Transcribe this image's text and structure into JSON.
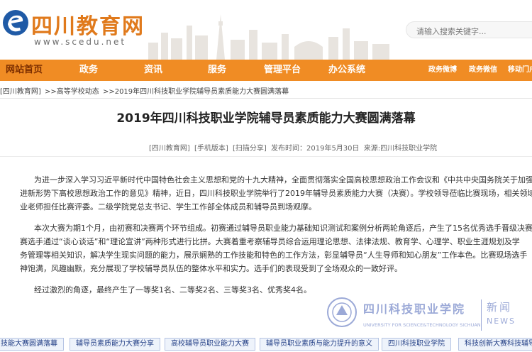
{
  "header": {
    "site_name": "四川教育网",
    "site_url": "www.scedu.net",
    "search_placeholder": "请输入搜索关键字..."
  },
  "nav": {
    "items": [
      {
        "label": "网站首页",
        "active": true
      },
      {
        "label": "政务"
      },
      {
        "label": "资讯"
      },
      {
        "label": "服务"
      },
      {
        "label": "管理平台"
      },
      {
        "label": "办公系统"
      }
    ],
    "right": [
      "政务微博",
      "政务微信",
      "移动门户"
    ]
  },
  "breadcrumb": [
    "[四川教育网]",
    ">>高等学校动态",
    ">>2019年四川科技职业学院辅导员素质能力大赛圆满落幕"
  ],
  "article": {
    "title": "2019年四川科技职业学院辅导员素质能力大赛圆满落幕",
    "meta": [
      "[四川教育网]",
      "[手机版本]",
      "[扫描分享]",
      "发布时间：2019年5月30日",
      "来源:四川科技职业学院"
    ],
    "paragraphs": [
      {
        "lines": [
          "为进一步深入学习习近平新时代中国特色社会主义思想和党的十九大精神，全面贯彻落实全国高校思想政治工作会议和《中共中央国务院关于加强",
          "进新形势下高校思想政治工作的意见》精神，近日，四川科技职业学院举行了2019年辅导员素质能力大赛（决赛）。学校领导莅临比赛现场，相关领域",
          "业老师担任比赛评委。二级学院党总支书记、学生工作部全体成员和辅导员到场观摩。"
        ]
      },
      {
        "lines": [
          "本次大赛为期1个月，由初赛和决赛两个环节组成。初赛通过辅导员职业能力基础知识测试和案例分析两轮角逐后，产生了15名优秀选手晋级决赛。",
          "赛选手通过“谈心谈话”和“理论宣讲”两种形式进行比拼。大赛着重考察辅导员综合运用理论思想、法律法规、教育学、心理学、职业生涯规划及学",
          "务管理等相关知识，解决学生现实问题的能力，展示娴熟的工作技能和特色的工作方法，彰显辅导员“人生导师和知心朋友”工作本色。比赛现场选手",
          "神饱满，风趣幽默，充分展现了学校辅导员队伍的整体水平和实力。选手们的表现受到了全场观众的一致好评。"
        ]
      },
      {
        "lines": [
          "经过激烈的角逐，最终产生了一等奖1名、二等奖2名、三等奖3名、优秀奖4名。"
        ]
      }
    ]
  },
  "watermark": {
    "school": "四川科技职业学院",
    "school_en": "UNIVERSITY FOR SCIENCE&TECHNOLOGY SICHUAN",
    "news": "新闻",
    "news_en": "NEWS"
  },
  "tags": [
    "技能大赛圆满落幕",
    "辅导员素质能力大赛分享",
    "高校辅导员职业能力大赛",
    "辅导员职业素质与能力提升的意义",
    "四川科技职业学院",
    "科技创新大赛科技辅导员"
  ],
  "colors": {
    "nav_bg": "#f08c24",
    "brand": "#e07a1c",
    "tag_text": "#233f86"
  }
}
